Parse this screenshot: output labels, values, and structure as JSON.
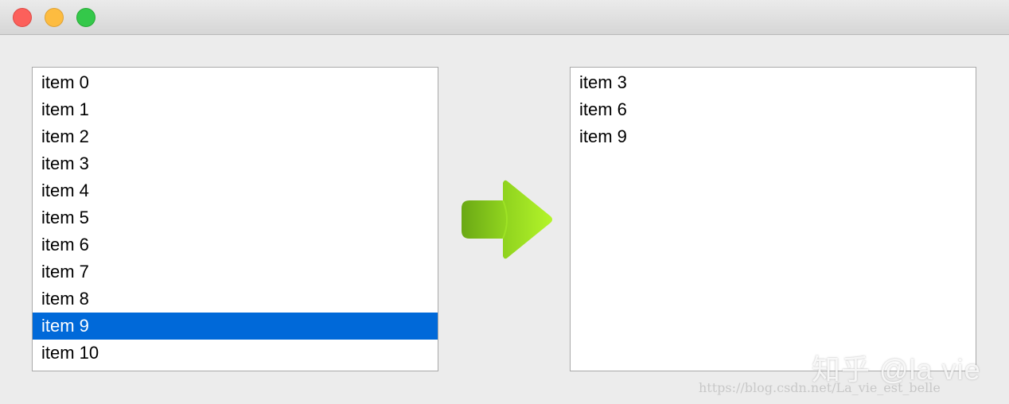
{
  "window": {
    "controls": {
      "close_icon": "close-traffic-light",
      "minimize_icon": "minimize-traffic-light",
      "zoom_icon": "zoom-traffic-light"
    }
  },
  "source_list": {
    "items": [
      "item 0",
      "item 1",
      "item 2",
      "item 3",
      "item 4",
      "item 5",
      "item 6",
      "item 7",
      "item 8",
      "item 9",
      "item 10"
    ],
    "selected_index": 9
  },
  "transfer_arrow": {
    "icon": "arrow-right-icon",
    "color": "#8ed11e"
  },
  "result_list": {
    "items": [
      "item 3",
      "item 6",
      "item 9"
    ]
  },
  "watermarks": {
    "zhihu": "知乎 @la vie",
    "url": "https://blog.csdn.net/La_vie_est_belle"
  },
  "colors": {
    "selection": "#0069d9",
    "window_bg": "#ececec"
  }
}
